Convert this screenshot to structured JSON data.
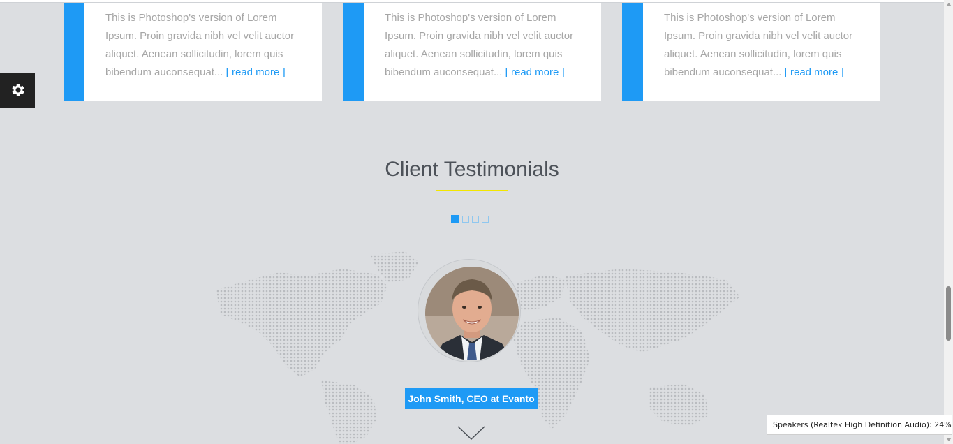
{
  "cards": [
    {
      "text": "This is Photoshop's version of Lorem Ipsum. Proin gravida nibh vel velit auctor aliquet. Aenean sollicitudin, lorem quis bibendum auconsequat...",
      "link": "[ read more ]"
    },
    {
      "text": "This is Photoshop's version of Lorem Ipsum. Proin gravida nibh vel velit auctor aliquet. Aenean sollicitudin, lorem quis bibendum auconsequat...",
      "link": "[ read more ]"
    },
    {
      "text": "This is Photoshop's version of Lorem Ipsum. Proin gravida nibh vel velit auctor aliquet. Aenean sollicitudin, lorem quis bibendum auconsequat...",
      "link": "[ read more ]"
    }
  ],
  "testimonials": {
    "heading": "Client Testimonials",
    "slides_count": 4,
    "active_slide": 1,
    "client_name": "John Smith, CEO at Evanto"
  },
  "settings": {
    "icon": "gear-icon"
  },
  "tooltip": {
    "text": "Speakers (Realtek High Definition Audio): 24%"
  },
  "colors": {
    "accent": "#1e9af5",
    "underline": "#f2e600",
    "background": "#dcdee1"
  }
}
